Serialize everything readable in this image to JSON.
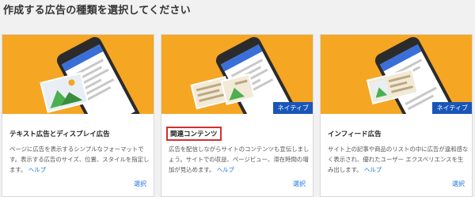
{
  "page": {
    "title": "作成する広告の種類を選択してください"
  },
  "cards": [
    {
      "title": "テキスト広告とディスプレイ広告",
      "badge": "",
      "description": "ページに広告を表示するシンプルなフォーマットです。表示する広告のサイズ、位置、スタイルを指定します。",
      "help_label": "ヘルプ",
      "select_label": "選択",
      "highlighted": false
    },
    {
      "title": "関連コンテンツ",
      "badge": "ネイティブ",
      "description": "広告を配信しながらサイトのコンテンツも宣伝しましょう。サイトでの収益、ページビュー、滞在時間の増加が見込めます。",
      "help_label": "ヘルプ",
      "select_label": "選択",
      "highlighted": true
    },
    {
      "title": "インフィード広告",
      "badge": "ネイティブ",
      "description": "サイト上の記事や商品のリストの中に広告が違和感なく表示され、優れたユーザー エクスペリエンスを生み出します。",
      "help_label": "ヘルプ",
      "select_label": "選択",
      "highlighted": false
    }
  ],
  "colors": {
    "hero_bg": "#f5a623",
    "badge_bg": "#1a56b8",
    "link": "#1a73e8",
    "highlight_border": "#d32f2f"
  }
}
